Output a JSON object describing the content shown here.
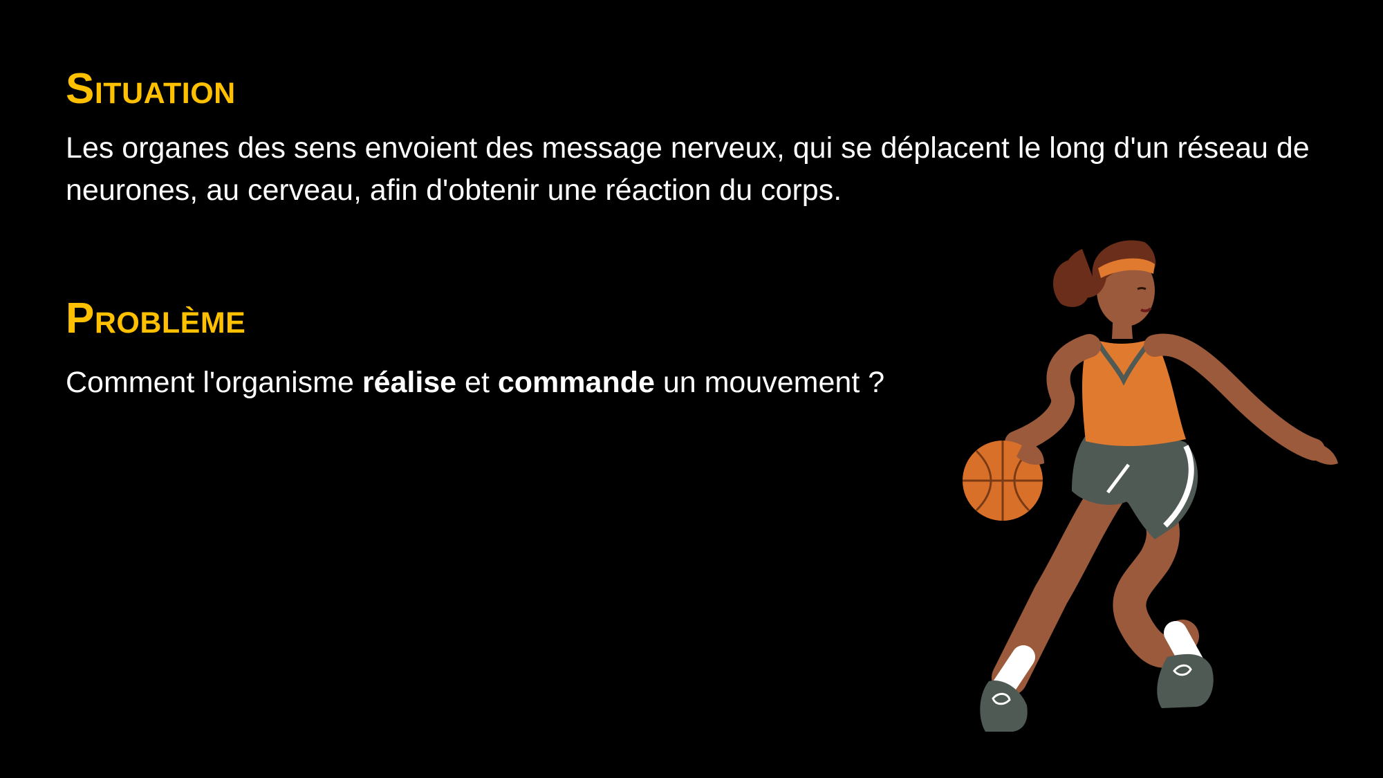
{
  "situation": {
    "heading": "Situation",
    "text": "Les organes des sens envoient des message nerveux, qui se déplacent le long d'un réseau de neurones, au cerveau, afin d'obtenir une réaction du corps."
  },
  "probleme": {
    "heading": "Problème",
    "text_before": "Comment l'organisme ",
    "bold_1": "réalise",
    "text_middle": " et ",
    "bold_2": "commande",
    "text_after": " un mouvement ?"
  },
  "colors": {
    "background": "#000000",
    "heading": "#FFC000",
    "body_text": "#FFFFFF",
    "jersey": "#E07A2E",
    "shorts": "#4F5A55",
    "skin": "#9C5A3C",
    "hair": "#6B2E1A",
    "ball": "#D9702A"
  },
  "illustration": {
    "icon": "basketball-player-icon"
  }
}
